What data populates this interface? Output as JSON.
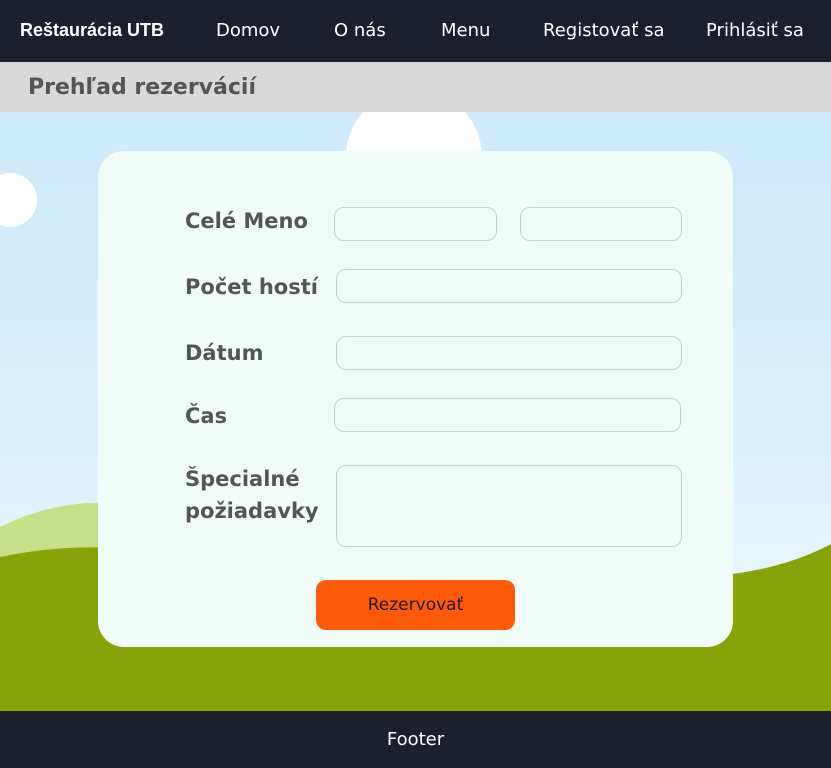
{
  "header": {
    "brand": "Reštaurácia UTB",
    "nav": [
      "Domov",
      "O nás",
      "Menu",
      "Registovať sa",
      "Prihlásiť sa"
    ]
  },
  "subheader": {
    "title": "Prehľad rezervácií"
  },
  "form": {
    "full_name_label": "Celé Meno",
    "first_name_value": "",
    "last_name_value": "",
    "guests_label": "Počet hostí",
    "guests_value": "",
    "date_label": "Dátum",
    "date_value": "",
    "time_label": "Čas",
    "time_value": "",
    "special_label_line1": "Špecialné",
    "special_label_line2": "požiadavky",
    "special_value": "",
    "submit_label": "Rezervovať"
  },
  "footer": {
    "text": "Footer"
  },
  "colors": {
    "navbar": "#1c202c",
    "subheader": "#d9d9d9",
    "card": "#f0fcf8",
    "accent_button": "#ff5a0a",
    "grass": "#87a307",
    "hill": "#c6e08a"
  }
}
